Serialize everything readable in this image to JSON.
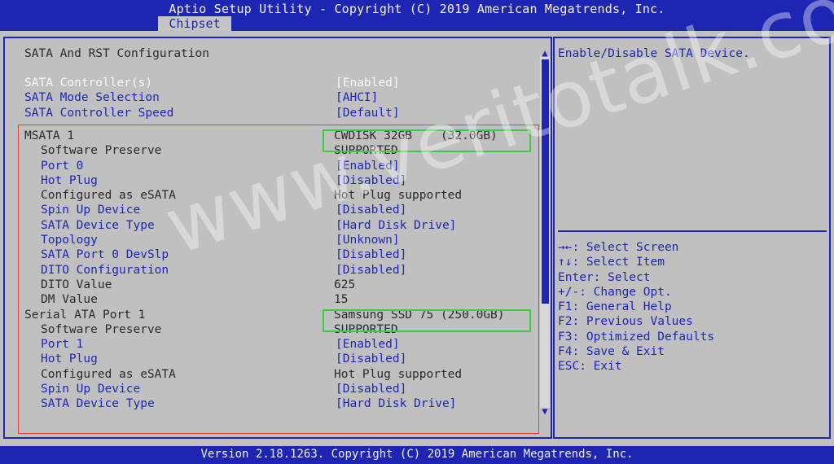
{
  "header": {
    "title": "Aptio Setup Utility - Copyright (C) 2019 American Megatrends, Inc.",
    "active_tab": "Chipset"
  },
  "main": {
    "section_title": "SATA And RST Configuration",
    "rows": [
      {
        "label": "SATA Controller(s)",
        "value": "[Enabled]",
        "style": "selected"
      },
      {
        "label": "SATA Mode Selection",
        "value": "[AHCI]",
        "style": "option"
      },
      {
        "label": "SATA Controller Speed",
        "value": "[Default]",
        "style": "option"
      },
      {
        "label": "MSATA 1",
        "value": "CWDISK 32GB    (32.0GB)",
        "style": "static"
      },
      {
        "label": "Software Preserve",
        "value": "SUPPORTED",
        "style": "static-sub"
      },
      {
        "label": "Port 0",
        "value": "[Enabled]",
        "style": "option-sub"
      },
      {
        "label": "Hot Plug",
        "value": "[Disabled]",
        "style": "option-sub"
      },
      {
        "label": "Configured as eSATA",
        "value": "Hot Plug supported",
        "style": "static-sub"
      },
      {
        "label": "Spin Up Device",
        "value": "[Disabled]",
        "style": "option-sub"
      },
      {
        "label": "SATA Device Type",
        "value": "[Hard Disk Drive]",
        "style": "option-sub"
      },
      {
        "label": "Topology",
        "value": "[Unknown]",
        "style": "option-sub"
      },
      {
        "label": "SATA Port 0 DevSlp",
        "value": "[Disabled]",
        "style": "option-sub"
      },
      {
        "label": "DITO Configuration",
        "value": "[Disabled]",
        "style": "option-sub"
      },
      {
        "label": "DITO Value",
        "value": "625",
        "style": "static-sub"
      },
      {
        "label": "DM Value",
        "value": "15",
        "style": "static-sub"
      },
      {
        "label": "Serial ATA Port 1",
        "value": "Samsung SSD 75 (250.0GB)",
        "style": "static"
      },
      {
        "label": "Software Preserve",
        "value": "SUPPORTED",
        "style": "static-sub"
      },
      {
        "label": "Port 1",
        "value": "[Enabled]",
        "style": "option-sub"
      },
      {
        "label": "Hot Plug",
        "value": "[Disabled]",
        "style": "option-sub"
      },
      {
        "label": "Configured as eSATA",
        "value": "Hot Plug supported",
        "style": "static-sub"
      },
      {
        "label": "Spin Up Device",
        "value": "[Disabled]",
        "style": "option-sub"
      },
      {
        "label": "SATA Device Type",
        "value": "[Hard Disk Drive]",
        "style": "option-sub"
      }
    ]
  },
  "help": {
    "description": "Enable/Disable SATA Device.",
    "keys": [
      "→←: Select Screen",
      "↑↓: Select Item",
      "Enter: Select",
      "+/-: Change Opt.",
      "F1: General Help",
      "F2: Previous Values",
      "F3: Optimized Defaults",
      "F4: Save & Exit",
      "ESC: Exit"
    ]
  },
  "footer": {
    "version": "Version 2.18.1263. Copyright (C) 2019 American Megatrends, Inc."
  },
  "watermark": "www.veritotalk.com",
  "colors": {
    "bios_blue": "#1f25b3",
    "background_gray": "#c0c0c0",
    "highlight_red": "#e04030",
    "highlight_green": "#3acc3a"
  },
  "icons": {
    "scroll_up": "triangle-up-icon",
    "scroll_down": "triangle-down-icon"
  }
}
